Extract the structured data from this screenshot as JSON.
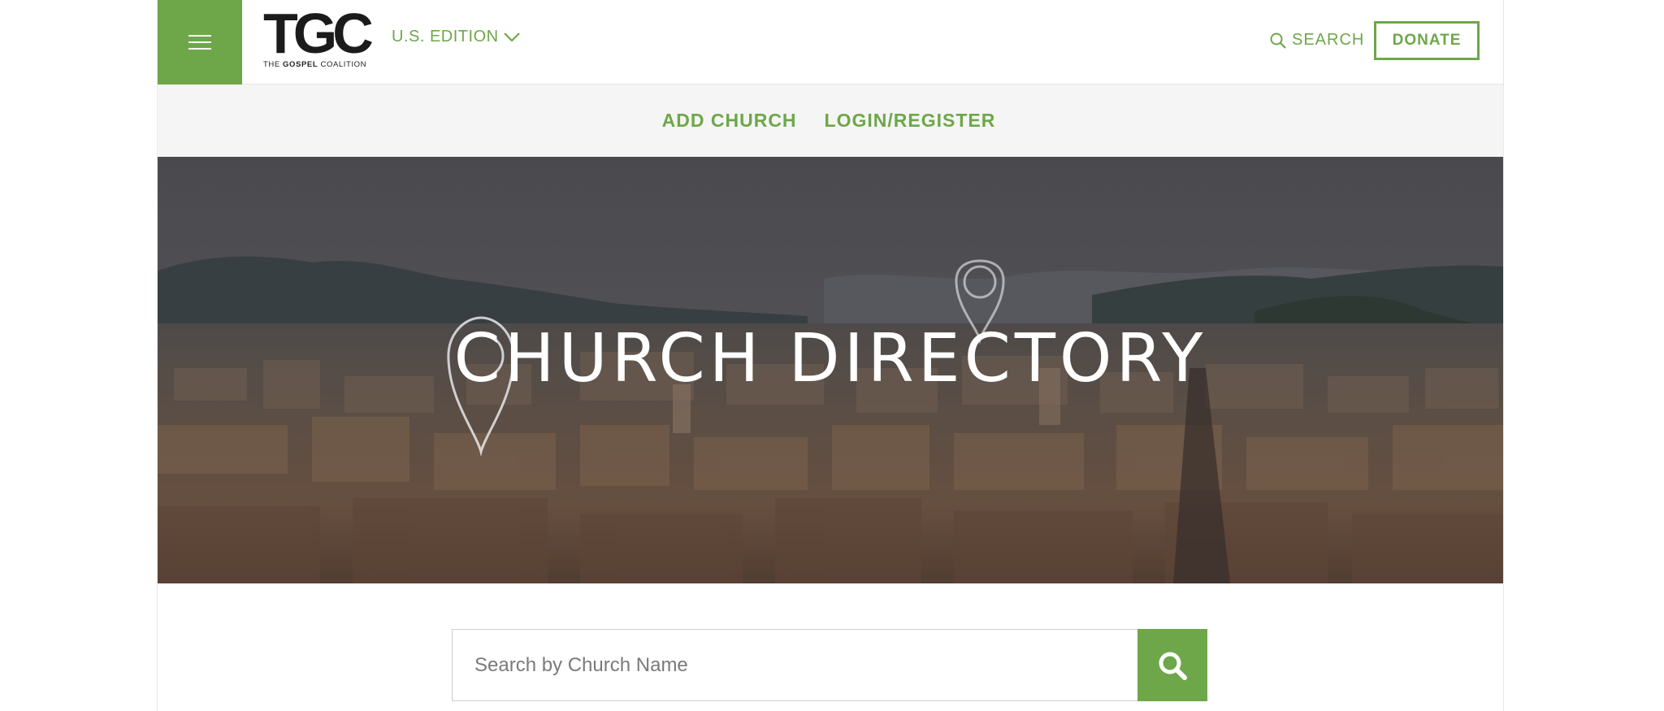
{
  "header": {
    "menu_icon": "hamburger-menu-icon",
    "logo_text": "TGC",
    "logo_sub_pre": "THE ",
    "logo_sub_bold": "GOSPEL",
    "logo_sub_post": " COALITION",
    "edition_label": "U.S. EDITION",
    "search_label": "SEARCH",
    "donate_label": "DONATE"
  },
  "subnav": {
    "items": [
      {
        "label": "ADD CHURCH"
      },
      {
        "label": "LOGIN/REGISTER"
      }
    ]
  },
  "hero": {
    "title": "CHURCH DIRECTORY"
  },
  "search": {
    "placeholder": "Search by Church Name",
    "value": "",
    "button_icon": "search-icon"
  },
  "colors": {
    "brand_green": "#6ea74a",
    "subnav_bg": "#f5f5f5"
  }
}
